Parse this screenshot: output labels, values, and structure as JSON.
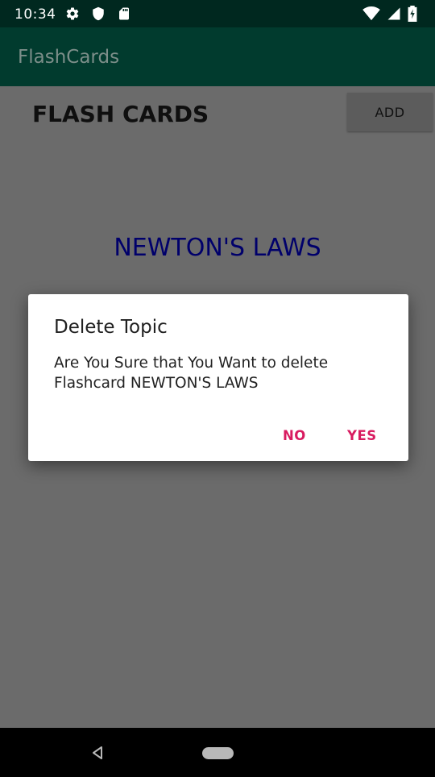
{
  "status_bar": {
    "time": "10:34",
    "icons": [
      "gear-icon",
      "shield-icon",
      "sd-card-icon",
      "wifi-icon",
      "signal-icon",
      "battery-charging-icon"
    ]
  },
  "app_bar": {
    "title": "FlashCards"
  },
  "main": {
    "heading": "FLASH CARDS",
    "add_label": "ADD",
    "topics": [
      "NEWTON'S LAWS"
    ]
  },
  "dialog": {
    "title": "Delete Topic",
    "message": "Are You Sure that You Want to delete Flashcard NEWTON'S LAWS",
    "negative_label": "NO",
    "positive_label": "YES"
  },
  "colors": {
    "status_bar": "#00281f",
    "app_bar": "#013b2e",
    "dialog_button": "#d81b60",
    "topic_text": "#00006b"
  }
}
